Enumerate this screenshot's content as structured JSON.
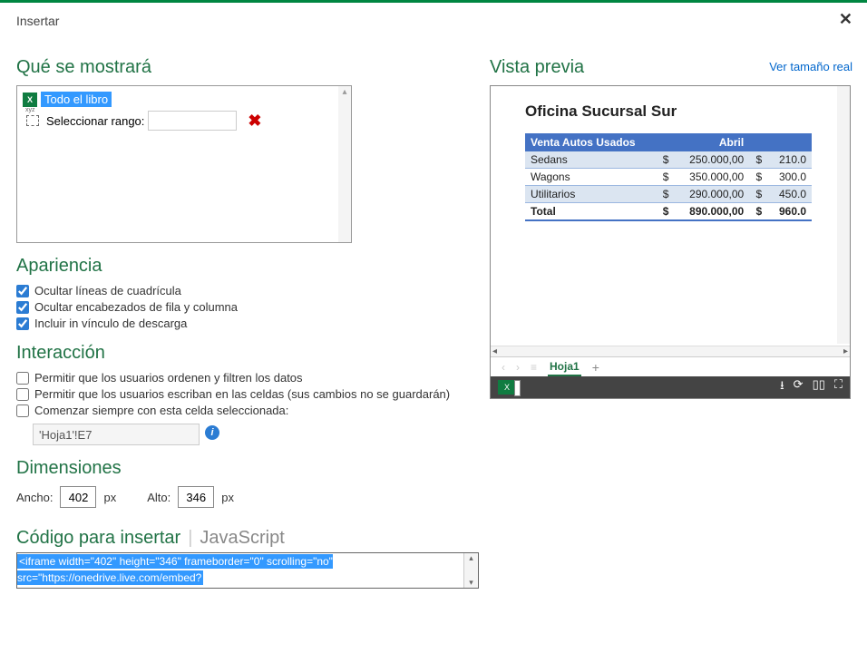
{
  "dialog_title": "Insertar",
  "sections": {
    "what": "Qué se mostrará",
    "appearance": "Apariencia",
    "interaction": "Interacción",
    "dimensions": "Dimensiones",
    "embed": "Código para insertar",
    "embed_js": "JavaScript",
    "preview": "Vista previa"
  },
  "what": {
    "whole_book": "Todo el libro",
    "select_range_label": "Seleccionar rango:"
  },
  "appearance": {
    "hide_gridlines": "Ocultar líneas de cuadrícula",
    "hide_headers": "Ocultar encabezados de fila y columna",
    "include_download": "Incluir in vínculo de descarga"
  },
  "interaction": {
    "allow_sort_filter": "Permitir que los usuarios ordenen y filtren los datos",
    "allow_write": "Permitir que los usuarios escriban en las celdas (sus cambios no se guardarán)",
    "start_cell": "Comenzar siempre con esta celda seleccionada:",
    "cell_value": "'Hoja1'!E7"
  },
  "dimensions": {
    "width_label": "Ancho:",
    "width_value": "402",
    "height_label": "Alto:",
    "height_value": "346",
    "px": "px"
  },
  "embed_code": "<iframe width=\"402\" height=\"346\" frameborder=\"0\" scrolling=\"no\" src=\"https://onedrive.live.com/embed?",
  "preview_link": "Ver tamaño real",
  "preview_data": {
    "title": "Oficina Sucursal Sur",
    "header_main": "Venta Autos Usados",
    "header_month": "Abril",
    "rows": [
      {
        "name": "Sedans",
        "v1": "250.000,00",
        "v2": "210.0"
      },
      {
        "name": "Wagons",
        "v1": "350.000,00",
        "v2": "300.0"
      },
      {
        "name": "Utilitarios",
        "v1": "290.000,00",
        "v2": "450.0"
      }
    ],
    "total_label": "Total",
    "total_v1": "890.000,00",
    "total_v2": "960.0",
    "sheet": "Hoja1"
  },
  "currency": "$",
  "excel_x": "X"
}
